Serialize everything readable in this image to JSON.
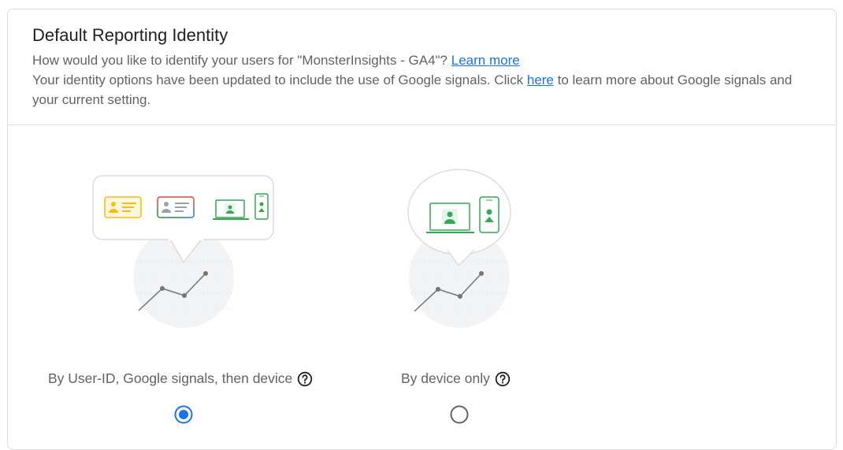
{
  "header": {
    "title": "Default Reporting Identity",
    "question": "How would you like to identify your users for \"MonsterInsights - GA4\"?",
    "learn_more": "Learn more",
    "update_prefix": "Your identity options have been updated to include the use of Google signals. Click",
    "here_link": "here",
    "update_suffix": "to learn more about Google signals and your current setting."
  },
  "options": [
    {
      "label": "By User-ID, Google signals, then device",
      "selected": true,
      "help_icon": "help-circle-icon"
    },
    {
      "label": "By device only",
      "selected": false,
      "help_icon": "help-circle-icon"
    }
  ],
  "colors": {
    "accent": "#1a73e8",
    "yellow": "#fbbc04",
    "green": "#34a853",
    "gray": "#5f6368",
    "border": "#dadce0"
  }
}
